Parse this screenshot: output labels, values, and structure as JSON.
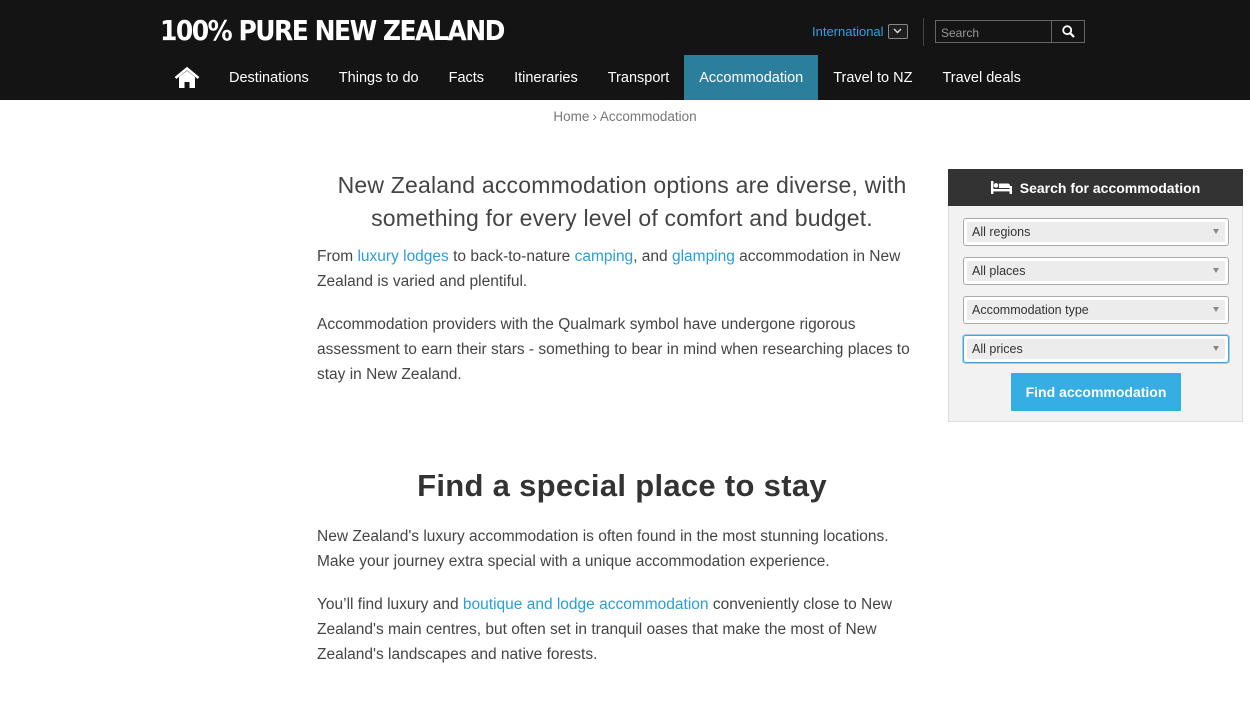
{
  "header": {
    "logo_text": "100% PURE NEW ZEALAND",
    "region_label": "International",
    "search_placeholder": "Search"
  },
  "nav": {
    "home_icon": "home-icon",
    "items": [
      {
        "label": "Destinations"
      },
      {
        "label": "Things to do"
      },
      {
        "label": "Facts"
      },
      {
        "label": "Itineraries"
      },
      {
        "label": "Transport"
      },
      {
        "label": "Accommodation",
        "active": true
      },
      {
        "label": "Travel to NZ"
      },
      {
        "label": "Travel deals"
      }
    ]
  },
  "breadcrumb": {
    "home": "Home",
    "separator": "›",
    "current": "Accommodation"
  },
  "intro": {
    "heading": "New Zealand accommodation options are diverse, with something for every level of comfort and budget.",
    "p1_prefix": "From ",
    "p1_link1": "luxury lodges",
    "p1_mid1": " to back-to-nature ",
    "p1_link2": "camping",
    "p1_mid2": ", and ",
    "p1_link3": "glamping",
    "p1_suffix": " accommodation in New Zealand is varied and plentiful.",
    "p2": "Accommodation providers with the Qualmark symbol have undergone rigorous assessment to earn their stars - something to bear in mind when researching places to stay in New Zealand."
  },
  "special": {
    "heading": "Find a special place to stay",
    "p1": "New Zealand's luxury accommodation is often found in the most stunning locations. Make your journey extra special with a unique accommodation experience.",
    "p2_prefix": "You’ll find luxury and ",
    "p2_link": "boutique and lodge accommodation",
    "p2_suffix": " conveniently close to New Zealand's main centres, but often set in tranquil oases that make the most of New Zealand's landscapes and native forests."
  },
  "sidebar": {
    "title": "Search for accommodation",
    "title_icon": "bed-icon",
    "selects": [
      {
        "value": "All regions"
      },
      {
        "value": "All places"
      },
      {
        "value": "Accommodation type"
      },
      {
        "value": "All prices"
      }
    ],
    "button": "Find accommodation"
  },
  "colors": {
    "header_bg": "#141414",
    "nav_active": "#2b7f9c",
    "link": "#2a9fd6",
    "button": "#35aee3",
    "sidebar_head": "#333333"
  }
}
